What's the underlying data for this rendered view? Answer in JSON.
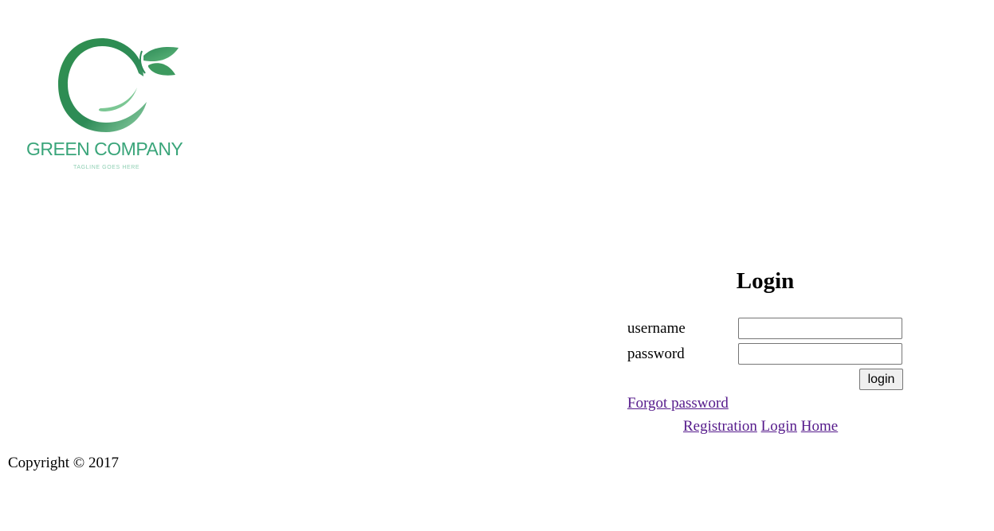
{
  "logo": {
    "name": "GREEN COMPANY",
    "tagline": "TAGLINE GOES HERE",
    "colors": {
      "primary": "#2e8b57",
      "text": "#3aa57a",
      "tagline": "#8fcfb3"
    }
  },
  "login": {
    "title": "Login",
    "username_label": "username",
    "password_label": "password",
    "username_value": "",
    "password_value": "",
    "button_label": "login"
  },
  "links": {
    "forgot_password": "Forgot password",
    "registration": "Registration",
    "login": "Login",
    "home": "Home",
    "color": "#551a8b"
  },
  "footer": {
    "copyright": "Copyright © 2017"
  }
}
